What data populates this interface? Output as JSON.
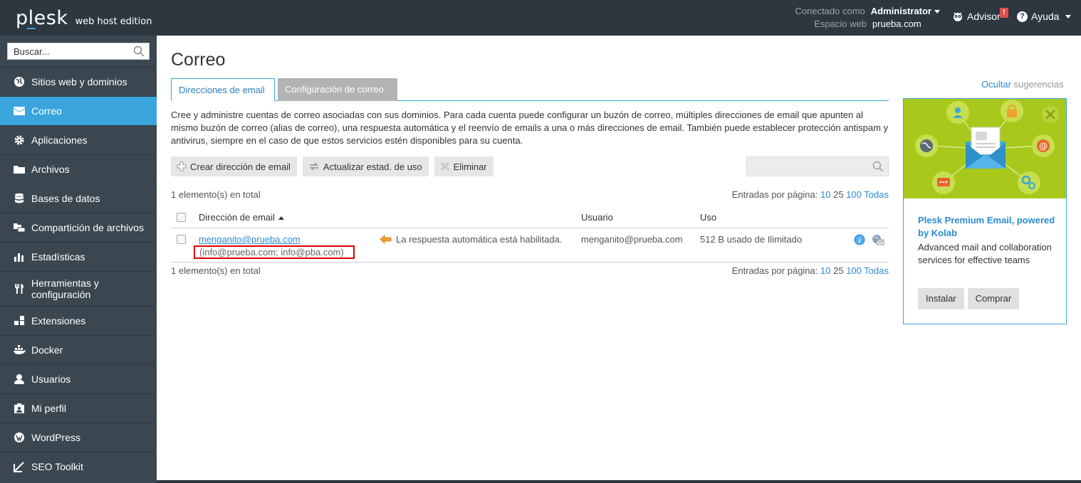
{
  "brand": {
    "name": "plesk",
    "edition": "web host edition"
  },
  "session": {
    "logged_label": "Conectado como",
    "user": "Administrator",
    "space_label": "Espacio web",
    "space": "prueba.com",
    "advisor": "Advisor",
    "advisor_badge": "!",
    "help": "Ayuda"
  },
  "sidebar": {
    "search_placeholder": "Buscar...",
    "items": [
      {
        "label": "Sitios web y dominios",
        "icon": "globe-icon"
      },
      {
        "label": "Correo",
        "icon": "mail-icon",
        "active": true
      },
      {
        "label": "Aplicaciones",
        "icon": "gear-icon"
      },
      {
        "label": "Archivos",
        "icon": "folder-icon"
      },
      {
        "label": "Bases de datos",
        "icon": "database-icon"
      },
      {
        "label": "Compartición de archivos",
        "icon": "file-sharing-icon"
      },
      {
        "label": "Estadísticas",
        "icon": "bar-chart-icon"
      },
      {
        "label": "Herramientas y configuración",
        "icon": "tools-icon"
      },
      {
        "label": "Extensiones",
        "icon": "extensions-icon"
      },
      {
        "label": "Docker",
        "icon": "docker-icon"
      },
      {
        "label": "Usuarios",
        "icon": "user-icon"
      },
      {
        "label": "Mi perfil",
        "icon": "profile-icon"
      },
      {
        "label": "WordPress",
        "icon": "wordpress-icon"
      },
      {
        "label": "SEO Toolkit",
        "icon": "seo-icon"
      }
    ]
  },
  "main": {
    "title": "Correo",
    "tabs": [
      {
        "label": "Direcciones de email",
        "active": true
      },
      {
        "label": "Configuración de correo",
        "active": false
      }
    ],
    "description": "Cree y administre cuentas de correo asociadas con sus dominios. Para cada cuenta puede configurar un buzón de correo, múltiples direcciones de email que apunten al mismo buzón de correo (alias de correo), una respuesta automática y el reenvío de emails a una o más direcciones de email. También puede establecer protección antispam y antivirus, siempre en el caso de que estos servicios estén disponibles para su cuenta.",
    "toolbar": {
      "create": "Crear dirección de email",
      "refresh": "Actualizar estad. de uso",
      "delete": "Eliminar"
    },
    "total": "1 elemento(s) en total",
    "per_page": {
      "label": "Entradas por página:",
      "options": [
        "10",
        "25",
        "100",
        "Todas"
      ],
      "current": "25"
    },
    "table": {
      "headers": {
        "email": "Dirección de email",
        "user": "Usuario",
        "usage": "Uso"
      },
      "rows": [
        {
          "email": "menganito@prueba.com",
          "aliases": "(info@prueba.com; info@pba.com)",
          "autoreply": "La respuesta automática está habilitada.",
          "user": "menganito@prueba.com",
          "usage": "512 B usado de Ilimitado"
        }
      ]
    }
  },
  "promo": {
    "hide_link": "Ocultar",
    "hide_suffix": "sugerencias",
    "title": "Plesk Premium Email, powered by Kolab",
    "text": "Advanced mail and collaboration services for effective teams",
    "install": "Instalar",
    "buy": "Comprar"
  },
  "colors": {
    "accent": "#3aa5dc",
    "topbar": "#2d3740",
    "sidebar": "#3b4750",
    "promo": "#a8c91c",
    "highlight": "#e00000"
  }
}
